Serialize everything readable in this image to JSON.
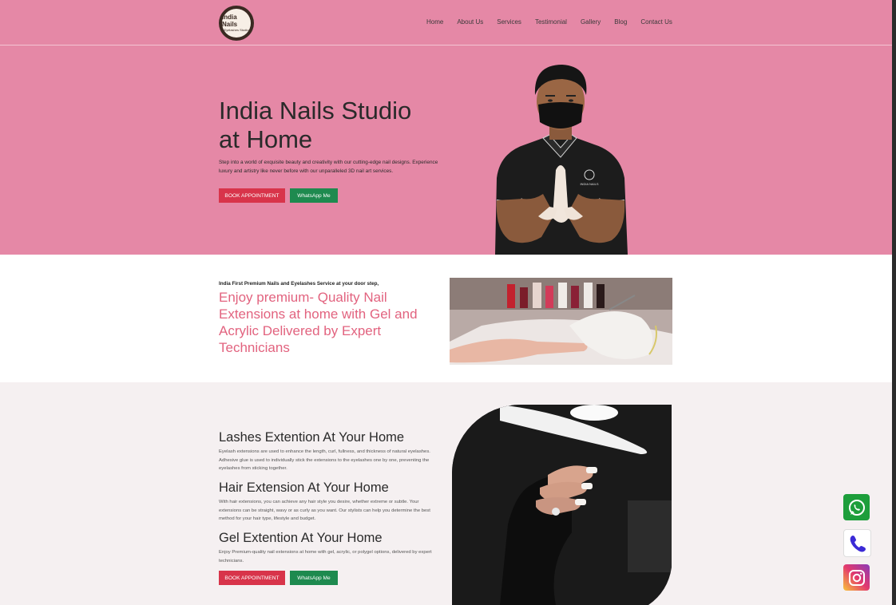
{
  "header": {
    "logo_line1": "India Nails",
    "logo_line2": "Eyelashes Studio",
    "nav": [
      "Home",
      "About Us",
      "Services",
      "Testimonial",
      "Gallery",
      "Blog",
      "Contact Us"
    ]
  },
  "hero": {
    "title_line1": "India Nails Studio",
    "title_line2": "at Home",
    "description": "Step into a world of exquisite beauty and creativity with our cutting-edge nail designs. Experience luxury and artistry like never before with our unparalleled 3D nail art services.",
    "book_label": "BOOK APPOINTMENT",
    "whatsapp_label": "WhatsApp Me",
    "shirt_text": "INDIA NAILS"
  },
  "intro": {
    "tagline": "India First Premium Nails and Eyelashes Service at your door step,",
    "headline": "Enjoy premium- Quality Nail Extensions at home with Gel and Acrylic Delivered by Expert Technicians"
  },
  "services": {
    "items": [
      {
        "title": "Lashes Extention At Your Home",
        "text": "Eyelash extensions are used to enhance the length, curl, fullness, and thickness of natural eyelashes. Adhesive glue is used to individually stick the extensions to the eyelashes one by one, preventing the eyelashes from sticking together."
      },
      {
        "title": "Hair Extension At Your Home",
        "text": "With hair extensions, you can achieve any hair style you desire, whether extreme or subtle. Your extensions can be straight, wavy or as curly as you want. Our stylists can help you determine the best method for your hair type, lifestyle and budget."
      },
      {
        "title": "Gel Extention At Your Home",
        "text": "Enjoy Premium-quality nail extensions at home with gel, acrylic, or polygel options, delivered by expert technicians."
      }
    ],
    "book_label": "BOOK APPOINTMENT",
    "whatsapp_label": "WhatsApp Me"
  },
  "floating": {
    "icons": [
      "whatsapp-icon",
      "phone-icon",
      "instagram-icon"
    ]
  },
  "colors": {
    "brand_pink": "#e588a6",
    "accent_pink": "#e2637f",
    "button_red": "#d8344a",
    "button_green": "#1e8a4f",
    "services_bg": "#f5f0f1"
  }
}
